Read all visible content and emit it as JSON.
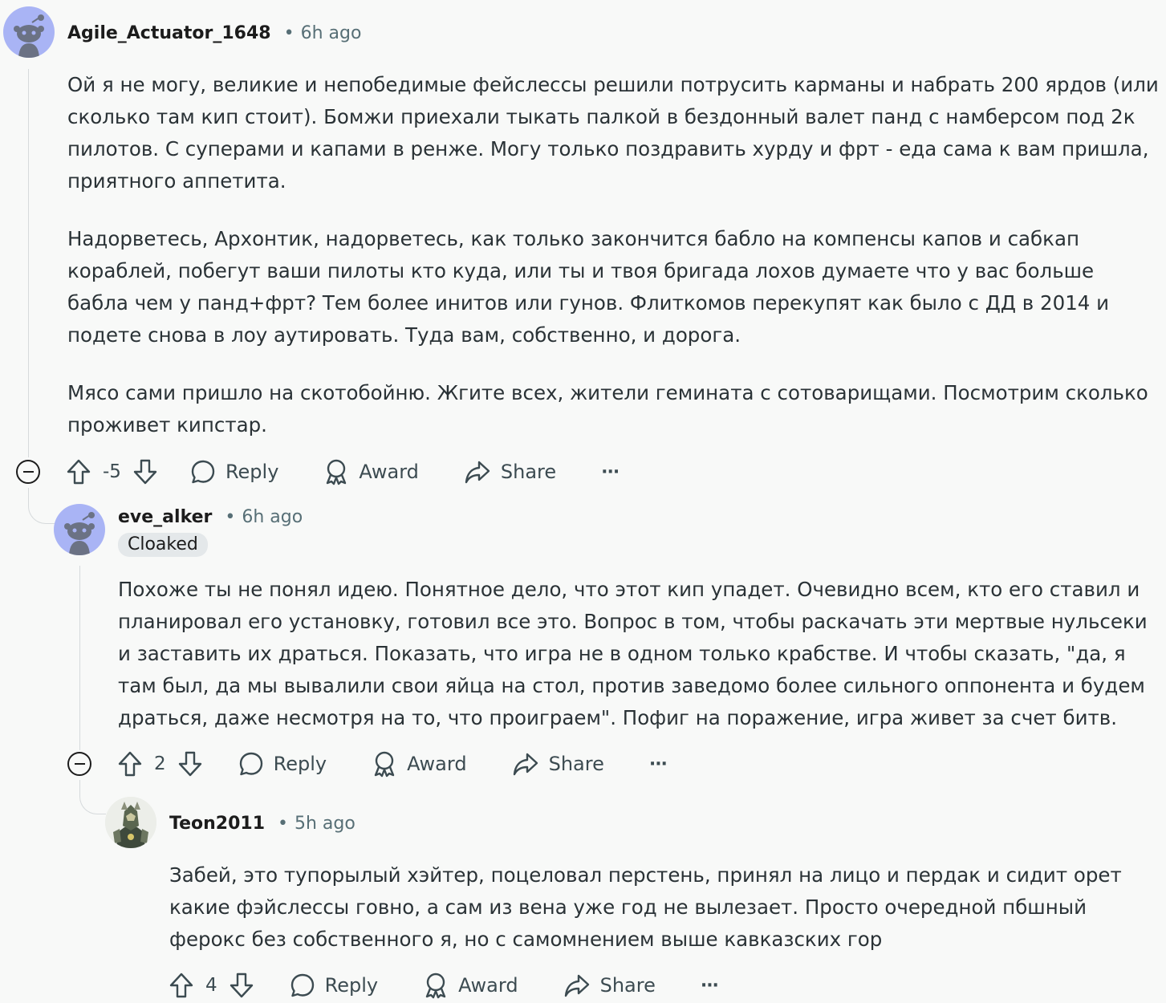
{
  "comments": [
    {
      "author": "Agile_Actuator_1648",
      "time": "6h ago",
      "paragraphs": [
        "Ой я не могу, великие и непобедимые фейслессы решили потрусить карманы и набрать 200 ярдов (или сколько там кип стоит). Бомжи приехали тыкать палкой в бездонный валет панд с намберсом под 2к пилотов. С суперами и капами в ренже. Могу только поздравить хурду и фрт - еда сама к вам пришла, приятного аппетита.",
        "Надорветесь, Архонтик, надорветесь, как только закончится бабло на компенсы капов и сабкап кораблей, побегут ваши пилоты кто куда, или ты и твоя бригада лохов думаете что у вас больше бабла чем у панд+фрт? Тем более инитов или гунов. Флиткомов перекупят как было с ДД в 2014 и подете снова в лоу аутировать. Туда вам, собственно, и дорога.",
        "Мясо сами пришло на скотобойню. Жгите всех, жители гемината с сотоварищами. Посмотрим сколько проживет кипстар."
      ],
      "votes": "-5",
      "reply_label": "Reply",
      "award_label": "Award",
      "share_label": "Share",
      "more_label": "···"
    },
    {
      "author": "eve_alker",
      "time": "6h ago",
      "flair": "Cloaked",
      "paragraphs": [
        "Похоже ты не понял идею. Понятное дело, что этот кип упадет. Очевидно всем, кто его ставил и планировал его установку, готовил все это. Вопрос в том, чтобы раскачать эти мертвые нульсеки и заставить их драться. Показать, что игра не в одном только крабстве. И чтобы сказать, \"да, я там был, да мы вывалили свои яйца на стол, против заведомо более сильного оппонента и будем драться, даже несмотря на то, что проиграем\". Пофиг на поражение, игра живет за счет битв."
      ],
      "votes": "2",
      "reply_label": "Reply",
      "award_label": "Award",
      "share_label": "Share",
      "more_label": "···"
    },
    {
      "author": "Teon2011",
      "time": "5h ago",
      "paragraphs": [
        "Забей, это тупорылый хэйтер, поцеловал перстень, принял на лицо и пердак и сидит орет какие фэйслессы говно, а сам из вена уже год не вылезает. Просто очередной пбшный ферокс без собственного я, но с самомнением выше кавказских гор"
      ],
      "votes": "4",
      "reply_label": "Reply",
      "award_label": "Award",
      "share_label": "Share",
      "more_label": "···"
    }
  ],
  "separator": "•",
  "colors": {
    "avatar_bg": "#a9b4f5",
    "snoo": "#6b7284",
    "thread_line": "#d6dadc",
    "meta": "#576f76"
  }
}
